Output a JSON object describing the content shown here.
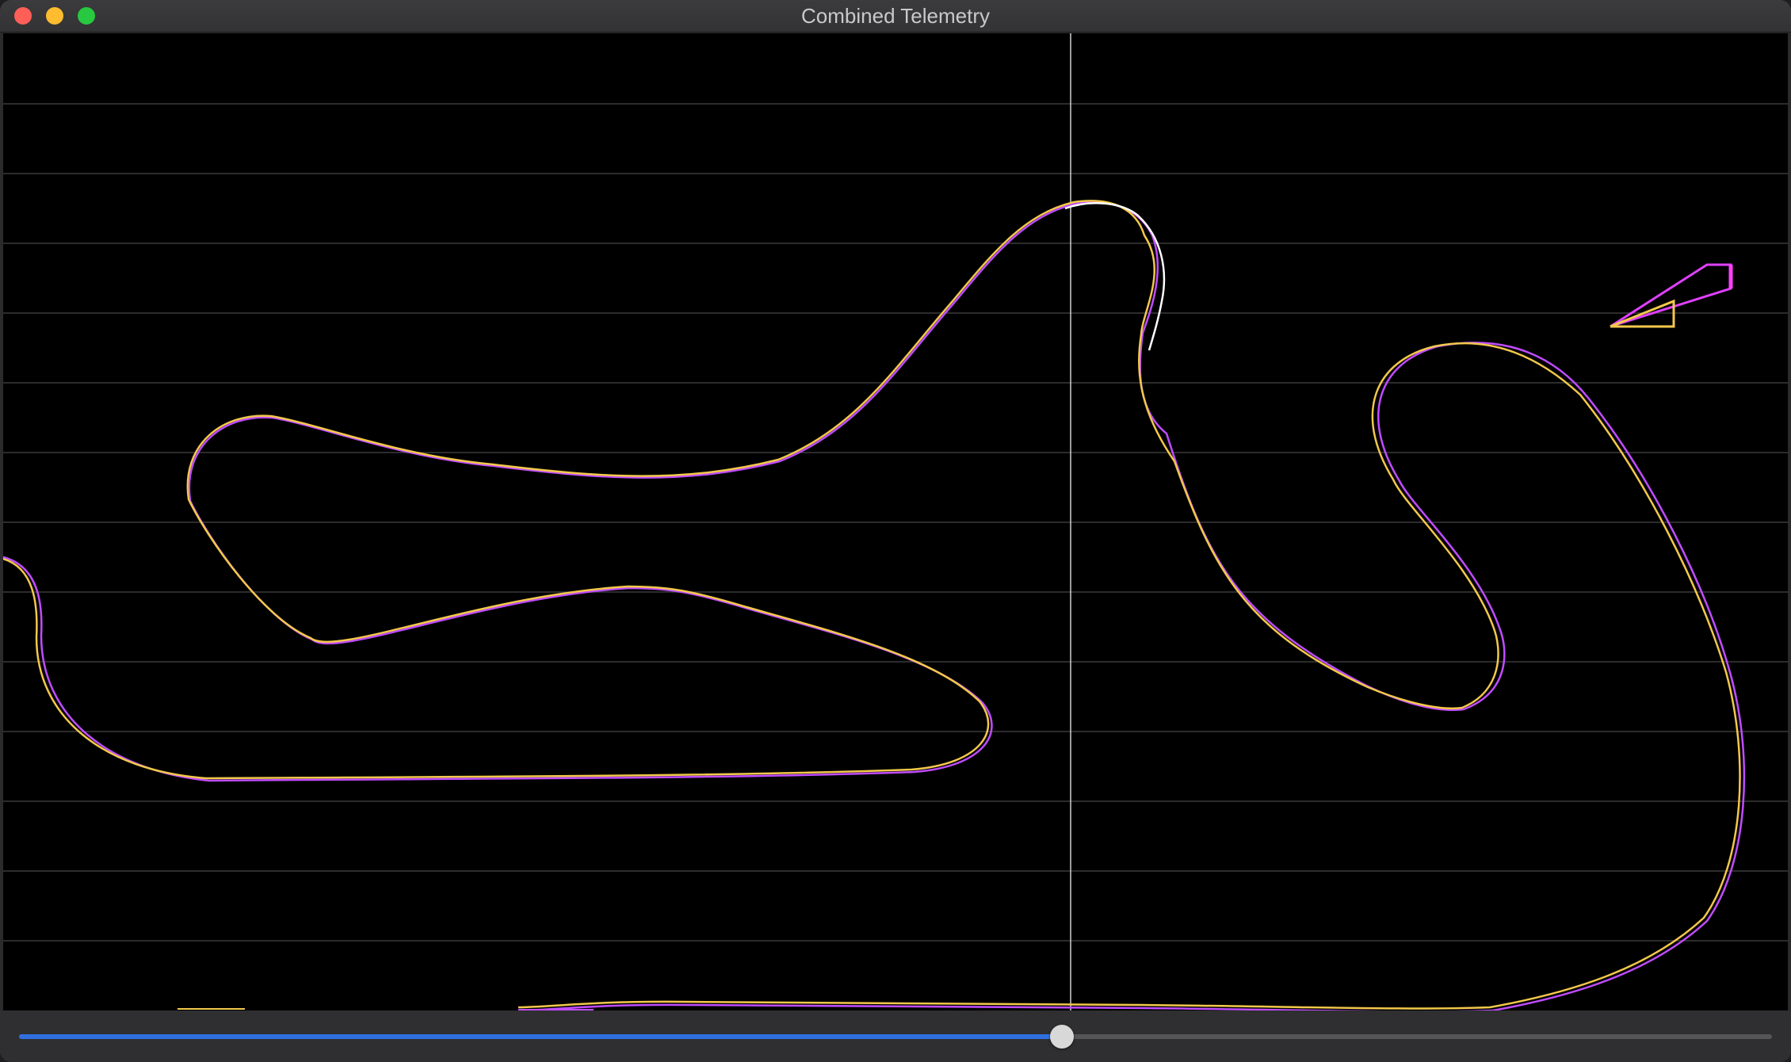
{
  "window": {
    "title": "Combined Telemetry"
  },
  "colors": {
    "background": "#000000",
    "grid": "#3a3a3a",
    "cursor_line": "#cfcfcf",
    "lap_a": "#c04cff",
    "lap_b": "#f2c84b",
    "slider_accent": "#2f6fe0"
  },
  "slider": {
    "value": 0.595
  },
  "legend_icons": [
    "magenta-wedge-icon",
    "yellow-wedge-icon"
  ]
}
